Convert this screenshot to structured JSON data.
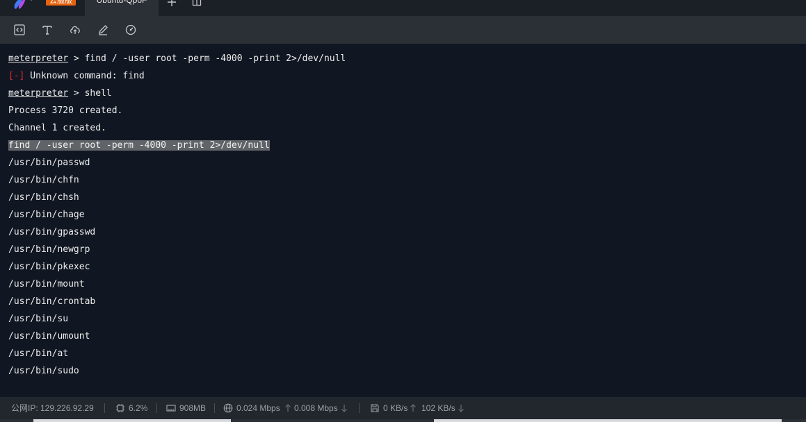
{
  "tabbar": {
    "badge": "云服版",
    "active_tab": "Ubuntu-QpoF"
  },
  "toolbar": {
    "icons": [
      "code-icon",
      "text-icon",
      "upload-icon",
      "edit-icon",
      "dashboard-icon"
    ]
  },
  "terminal": {
    "lines": [
      {
        "prompt": "meterpreter",
        "sep": " > ",
        "cmd": "find / -user root -perm -4000 -print 2>/dev/null"
      },
      {
        "err_tag": "[-]",
        "text": " Unknown command: find"
      },
      {
        "prompt": "meterpreter",
        "sep": " > ",
        "cmd": "shell"
      },
      {
        "text": "Process 3720 created."
      },
      {
        "text": "Channel 1 created."
      },
      {
        "text": "find / -user root -perm -4000 -print 2>/dev/null"
      },
      {
        "text": "/usr/bin/passwd"
      },
      {
        "text": "/usr/bin/chfn"
      },
      {
        "text": "/usr/bin/chsh"
      },
      {
        "text": "/usr/bin/chage"
      },
      {
        "text": "/usr/bin/gpasswd"
      },
      {
        "text": "/usr/bin/newgrp"
      },
      {
        "text": "/usr/bin/pkexec"
      },
      {
        "text": "/usr/bin/mount"
      },
      {
        "text": "/usr/bin/crontab"
      },
      {
        "text": "/usr/bin/su"
      },
      {
        "text": "/usr/bin/umount"
      },
      {
        "text": "/usr/bin/at"
      },
      {
        "text": "/usr/bin/sudo"
      }
    ]
  },
  "status": {
    "public_ip": "公网IP: 129.226.92.29",
    "cpu": "6.2%",
    "memory": "908MB",
    "net_up": "0.024 Mbps",
    "net_down": "0.008 Mbps",
    "disk_read": "0 KB/s",
    "disk_write": "102 KB/s"
  },
  "colors": {
    "terminal_bg": "#111722",
    "error_red": "#e0262a",
    "selection": "#606468",
    "badge_orange": "#e8610c"
  }
}
